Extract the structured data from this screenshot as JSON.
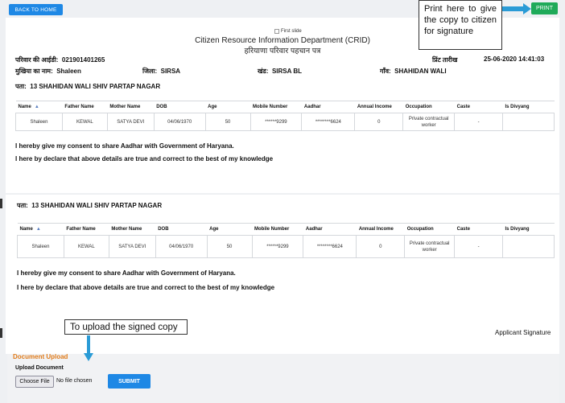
{
  "header": {
    "back_label": "BACK TO HOME",
    "print_label": "PRINT"
  },
  "annotations": {
    "print_callout": "Print here to give the copy to citizen for signature",
    "upload_callout": "To upload the signed copy"
  },
  "sheet": {
    "logo_alt": "First slide",
    "dept_title": "Citizen Resource Information Department (CRID)",
    "dept_subtitle": "हरियाणा परिवार पहचान पत्र",
    "family_id_label": "परिवार की आईडी:",
    "family_id": "021901401265",
    "print_date_label": "प्रिंट तारीख",
    "print_date": "25-06-2020 14:41:03",
    "head_label": "मुखिया का नाम:",
    "head_name": "Shaleen",
    "district_label": "जिला:",
    "district": "SIRSA",
    "block_label": "खंड:",
    "block": "SIRSA BL",
    "village_label": "गाँव:",
    "village": "SHAHIDAN WALI",
    "address_label": "पता:",
    "address": "13 SHAHIDAN WALI SHIV PARTAP NAGAR",
    "table": {
      "headers": [
        "Name",
        "Father Name",
        "Mother Name",
        "DOB",
        "Age",
        "Mobile Number",
        "Aadhar",
        "Annual Income",
        "Occupation",
        "Caste",
        "Is Divyang"
      ],
      "row": [
        "Shaleen",
        "KEWAL",
        "SATYA DEVI",
        "04/06/1970",
        "50",
        "******9299",
        "********6624",
        "0",
        "Private contractual worker",
        "-",
        ""
      ]
    },
    "consent_text": "I hereby give my consent to share Aadhar with Government of Haryana.",
    "declare_text": "I here by declare that above details are true and correct to the best of my knowledge",
    "applicant_signature": "Applicant Signature"
  },
  "upload": {
    "title": "Document Upload",
    "label": "Upload Document",
    "choose_file": "Choose File",
    "no_file": "No file chosen",
    "submit_label": "SUBMIT"
  }
}
